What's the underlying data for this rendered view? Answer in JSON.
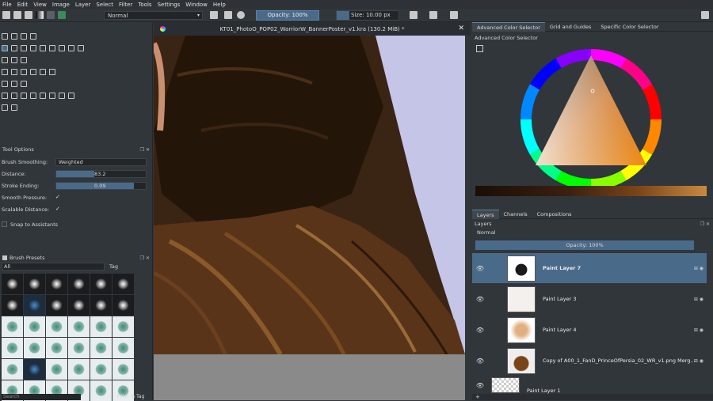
{
  "menu": [
    "File",
    "Edit",
    "View",
    "Image",
    "Layer",
    "Select",
    "Filter",
    "Tools",
    "Settings",
    "Window",
    "Help"
  ],
  "toolbar": {
    "blend_mode": "Normal",
    "opacity_label": "Opacity: 100%",
    "opacity_fraction": 1.0,
    "size_label": "Size: 10.00 px"
  },
  "canvas": {
    "title": "KT01_PhotoO_POP02_WarriorW_BannerPoster_v1.kra (130.2 MiB) *",
    "close": "✕"
  },
  "tool_options": {
    "title": "Tool Options",
    "brush_smoothing_label": "Brush Smoothing:",
    "brush_smoothing_value": "Weighted",
    "distance_label": "Distance:",
    "distance_value": "83.2",
    "stroke_ending_label": "Stroke Ending:",
    "stroke_ending_value": "0.09",
    "smooth_pressure_label": "Smooth Pressure:",
    "scalable_distance_label": "Scalable Distance:",
    "snap_label": "Snap to Assistants",
    "check": "✓"
  },
  "brush_presets": {
    "title": "Brush Presets",
    "filter_value": "All",
    "tag_label": "Tag",
    "search_placeholder": "Search",
    "filter_in_tag_label": "Filter in Tag"
  },
  "color_panel": {
    "tabs": [
      "Advanced Color Selector",
      "Grid and Guides",
      "Specific Color Selector"
    ],
    "title": "Advanced Color Selector"
  },
  "layers_panel": {
    "tabs": [
      "Layers",
      "Channels",
      "Compositions"
    ],
    "title": "Layers",
    "blend_mode": "Normal",
    "opacity_label": "Opacity:  100%",
    "layers": [
      {
        "name": "Paint Layer 7",
        "active": true
      },
      {
        "name": "Paint Layer 3",
        "active": false
      },
      {
        "name": "Paint Layer 4",
        "active": false
      },
      {
        "name": "Copy of A00_1_FanD_PrinceOfPersia_02_WR_v1.png Merg...",
        "active": false
      },
      {
        "name": "Paint Layer 1",
        "active": false
      }
    ]
  },
  "colors": {
    "accent": "#4a6a8a",
    "panel_bg": "#31363b",
    "canvas_bg": "#c5c5e8",
    "robe_dark": "#2a1a0e",
    "robe_mid": "#5a3418"
  }
}
